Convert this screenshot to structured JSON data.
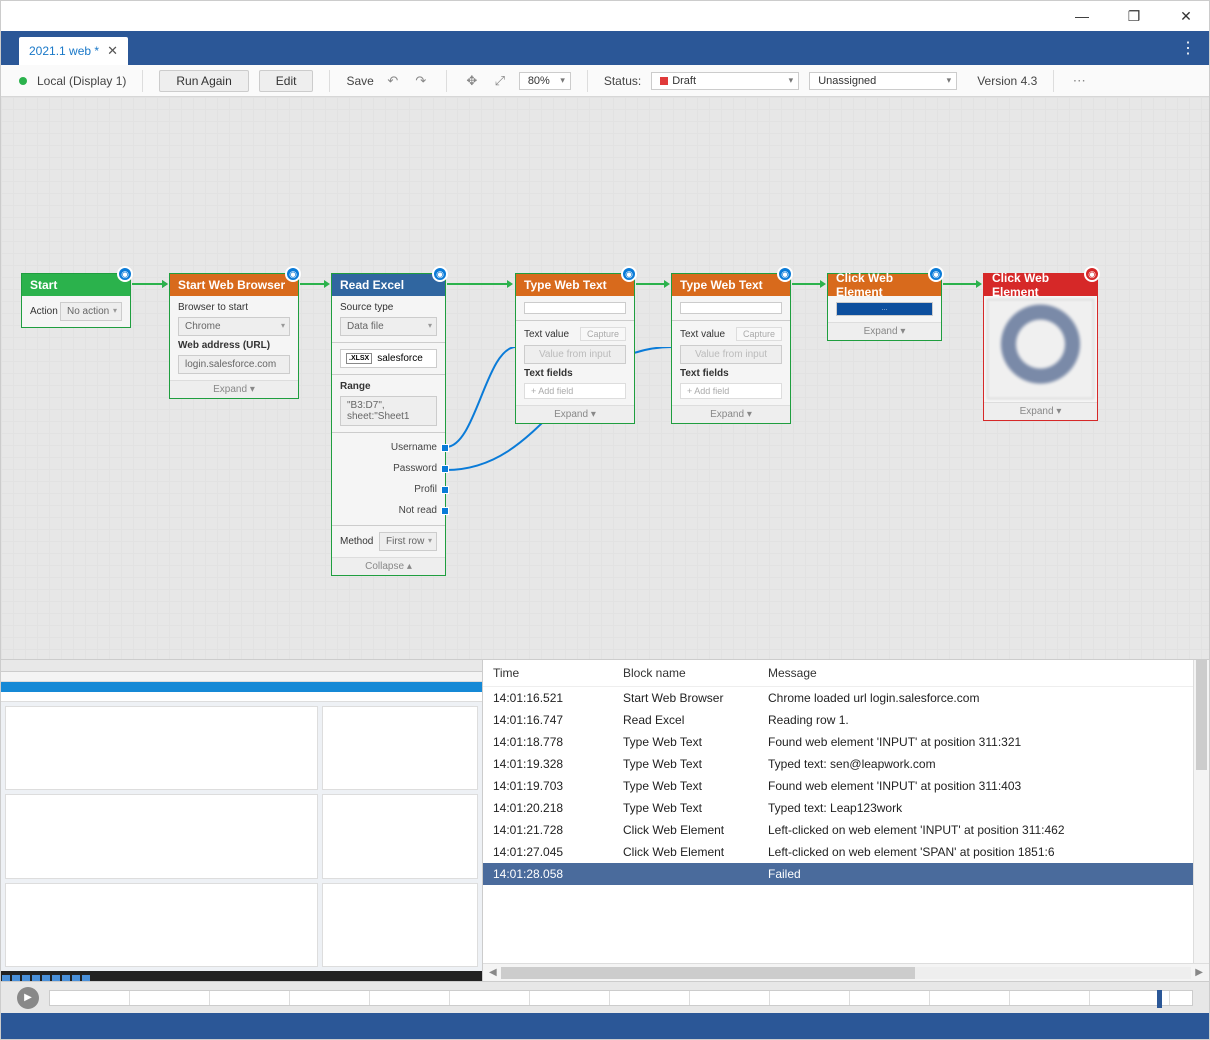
{
  "window": {
    "min": "—",
    "max": "❐",
    "close": "✕"
  },
  "tab": {
    "title": "2021.1 web *",
    "close": "✕"
  },
  "toolbar": {
    "local": "Local (Display 1)",
    "run": "Run Again",
    "edit": "Edit",
    "save": "Save",
    "zoom": "80%",
    "statusLabel": "Status:",
    "status": "Draft",
    "assignee": "Unassigned",
    "version": "Version 4.3",
    "more": "⋯"
  },
  "nodes": {
    "start": {
      "title": "Start",
      "actionLbl": "Action",
      "action": "No action"
    },
    "browser": {
      "title": "Start Web Browser",
      "browserLbl": "Browser to start",
      "browser": "Chrome",
      "urlLbl": "Web address (URL)",
      "url": "login.salesforce.com",
      "expand": "Expand ▾"
    },
    "excel": {
      "title": "Read Excel",
      "srcLbl": "Source type",
      "src": "Data file",
      "file": "salesforce",
      "rangeLbl": "Range",
      "range": "\"B3:D7\", sheet:\"Sheet1",
      "out1": "Username",
      "out2": "Password",
      "out3": "Profil",
      "out4": "Not read",
      "methodLbl": "Method",
      "method": "First row",
      "collapse": "Collapse ▴"
    },
    "type1": {
      "title": "Type Web Text",
      "txtLbl": "Text value",
      "capture": "Capture",
      "valBtn": "Value from input",
      "fieldsLbl": "Text fields",
      "add": "+  Add field",
      "expand": "Expand ▾"
    },
    "type2": {
      "title": "Type Web Text",
      "txtLbl": "Text value",
      "capture": "Capture",
      "valBtn": "Value from input",
      "fieldsLbl": "Text fields",
      "add": "+  Add field",
      "expand": "Expand ▾"
    },
    "click1": {
      "title": "Click Web Element",
      "btn": "···",
      "expand": "Expand ▾"
    },
    "click2": {
      "title": "Click Web Element",
      "expand": "Expand ▾"
    }
  },
  "log": {
    "headers": {
      "time": "Time",
      "block": "Block name",
      "msg": "Message"
    },
    "rows": [
      {
        "t": "14:01:16.521",
        "b": "Start Web Browser",
        "m": "Chrome loaded url login.salesforce.com"
      },
      {
        "t": "14:01:16.747",
        "b": "Read Excel",
        "m": "Reading row 1."
      },
      {
        "t": "14:01:18.778",
        "b": "Type Web Text",
        "m": "Found web element 'INPUT' at position 311:321"
      },
      {
        "t": "14:01:19.328",
        "b": "Type Web Text",
        "m": "Typed text: sen@leapwork.com"
      },
      {
        "t": "14:01:19.703",
        "b": "Type Web Text",
        "m": "Found web element 'INPUT' at position 311:403"
      },
      {
        "t": "14:01:20.218",
        "b": "Type Web Text",
        "m": "Typed text: Leap123work"
      },
      {
        "t": "14:01:21.728",
        "b": "Click Web Element",
        "m": "Left-clicked on web element 'INPUT' at position 311:462"
      },
      {
        "t": "14:01:27.045",
        "b": "Click Web Element",
        "m": "Left-clicked on web element 'SPAN' at position 1851:6"
      },
      {
        "t": "14:01:28.058",
        "b": "",
        "m": "Failed",
        "fail": true
      }
    ]
  }
}
